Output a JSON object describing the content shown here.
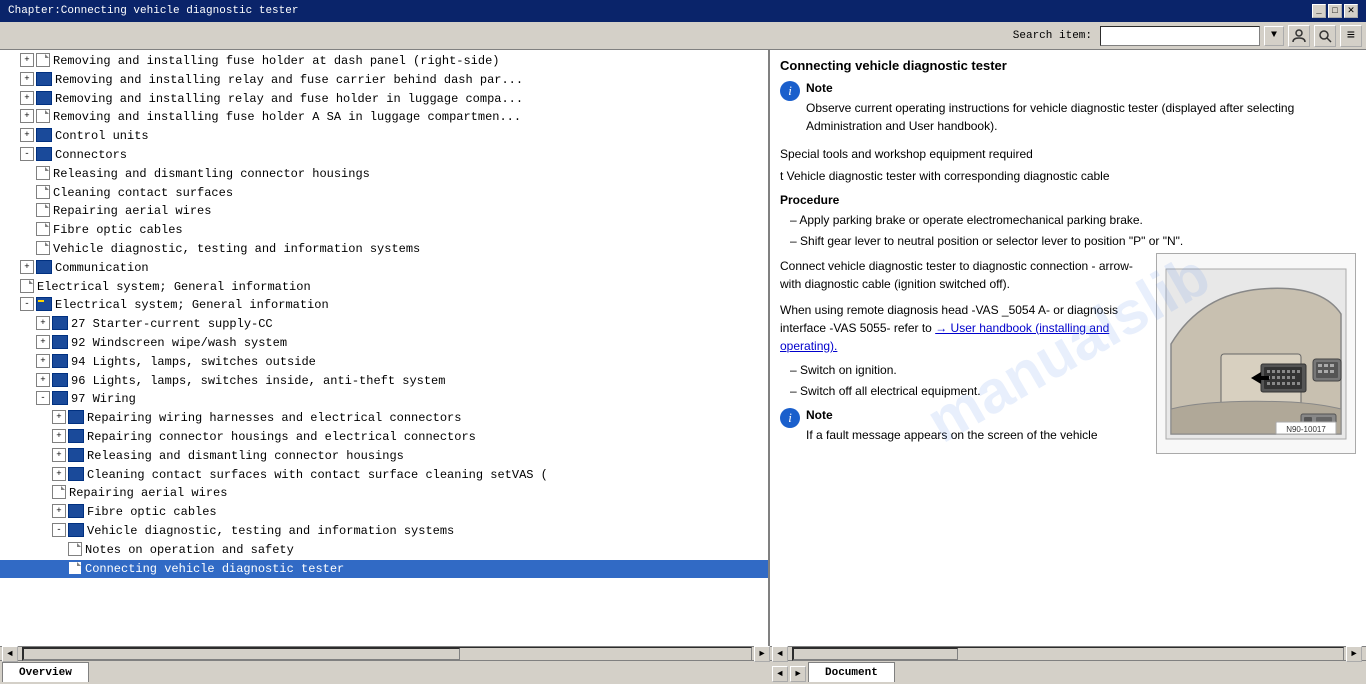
{
  "titlebar": {
    "title": "Chapter:Connecting vehicle diagnostic tester"
  },
  "toolbar": {
    "search_label": "Search item:",
    "search_placeholder": "",
    "btn_user": "👤",
    "btn_print": "🖨",
    "btn_menu": "☰"
  },
  "tree": {
    "items": [
      {
        "id": 1,
        "indent": "tree-indent-1",
        "type": "doc",
        "expand": "+",
        "label": "Removing and installing fuse holder at dash panel (right-side)"
      },
      {
        "id": 2,
        "indent": "tree-indent-1",
        "type": "doc",
        "expand": "+",
        "label": "Removing and installing relay and fuse carrier behind dash par..."
      },
      {
        "id": 3,
        "indent": "tree-indent-1",
        "type": "doc",
        "expand": "+",
        "label": "Removing and installing relay and fuse holder in luggage compa..."
      },
      {
        "id": 4,
        "indent": "tree-indent-1",
        "type": "doc",
        "expand": "+",
        "label": "Removing and installing fuse holder A SA in luggage compartmen..."
      },
      {
        "id": 5,
        "indent": "tree-indent-1",
        "type": "book",
        "expand": "+",
        "label": "Control units"
      },
      {
        "id": 6,
        "indent": "tree-indent-1",
        "type": "book",
        "expand": "-",
        "label": "Connectors"
      },
      {
        "id": 7,
        "indent": "tree-indent-2",
        "type": "doc",
        "label": "Releasing and dismantling connector housings"
      },
      {
        "id": 8,
        "indent": "tree-indent-2",
        "type": "doc",
        "label": "Cleaning contact surfaces"
      },
      {
        "id": 9,
        "indent": "tree-indent-2",
        "type": "doc",
        "label": "Repairing aerial wires"
      },
      {
        "id": 10,
        "indent": "tree-indent-2",
        "type": "doc",
        "label": "Fibre optic cables"
      },
      {
        "id": 11,
        "indent": "tree-indent-2",
        "type": "doc",
        "label": "Vehicle diagnostic, testing and information systems"
      },
      {
        "id": 12,
        "indent": "tree-indent-1",
        "type": "book",
        "expand": "+",
        "label": "Communication"
      },
      {
        "id": 13,
        "indent": "tree-indent-1",
        "type": "doc",
        "label": "Electrical system; General information"
      },
      {
        "id": 14,
        "indent": "tree-indent-1",
        "type": "book",
        "expand": "-",
        "label": "Electrical system; General information"
      },
      {
        "id": 15,
        "indent": "tree-indent-2",
        "type": "book",
        "expand": "+",
        "label": "27 Starter-current supply-CC"
      },
      {
        "id": 16,
        "indent": "tree-indent-2",
        "type": "book",
        "expand": "+",
        "label": "92 Windscreen wipe/wash system"
      },
      {
        "id": 17,
        "indent": "tree-indent-2",
        "type": "book",
        "expand": "+",
        "label": "94 Lights, lamps, switches outside"
      },
      {
        "id": 18,
        "indent": "tree-indent-2",
        "type": "book",
        "expand": "+",
        "label": "96 Lights, lamps, switches inside, anti-theft system"
      },
      {
        "id": 19,
        "indent": "tree-indent-2",
        "type": "book",
        "expand": "-",
        "label": "97 Wiring"
      },
      {
        "id": 20,
        "indent": "tree-indent-3",
        "type": "book",
        "expand": "+",
        "label": "Repairing wiring harnesses and electrical connectors"
      },
      {
        "id": 21,
        "indent": "tree-indent-3",
        "type": "book",
        "expand": "+",
        "label": "Repairing connector housings and electrical connectors"
      },
      {
        "id": 22,
        "indent": "tree-indent-3",
        "type": "book",
        "expand": "+",
        "label": "Releasing and dismantling connector housings"
      },
      {
        "id": 23,
        "indent": "tree-indent-3",
        "type": "book",
        "expand": "+",
        "label": "Cleaning contact surfaces with contact surface cleaning setVAS ("
      },
      {
        "id": 24,
        "indent": "tree-indent-3",
        "type": "doc",
        "label": "Repairing aerial wires"
      },
      {
        "id": 25,
        "indent": "tree-indent-3",
        "type": "book",
        "expand": "+",
        "label": "Fibre optic cables"
      },
      {
        "id": 26,
        "indent": "tree-indent-3",
        "type": "book",
        "expand": "-",
        "label": "Vehicle diagnostic, testing and information systems"
      },
      {
        "id": 27,
        "indent": "tree-indent-4",
        "type": "doc",
        "label": "Notes on operation and safety"
      },
      {
        "id": 28,
        "indent": "tree-indent-4",
        "type": "doc",
        "label": "Connecting vehicle diagnostic tester",
        "active": true
      }
    ]
  },
  "right": {
    "title": "Connecting vehicle diagnostic tester",
    "note_label": "Note",
    "note_text": "Observe current operating instructions for vehicle diagnostic tester (displayed after selecting Administration and User handbook).",
    "special_tools": "Special tools and workshop equipment required",
    "tool_item": "t  Vehicle diagnostic tester with corresponding diagnostic cable",
    "procedure_header": "Procedure",
    "steps": [
      "Apply parking brake or operate electromechanical parking brake.",
      "Shift gear lever to neutral position or selector lever to position \"P\" or \"N\"."
    ],
    "connect_text": "Connect vehicle diagnostic tester to diagnostic connection - arrow- with diagnostic cable (ignition switched off).",
    "remote_text": "When using remote diagnosis head -VAS _5054 A- or diagnosis interface -VAS 5055- refer to",
    "link_text": "→ User handbook (installing and operating).",
    "switch_on": "Switch on ignition.",
    "switch_off": "Switch off all electrical equipment.",
    "note2_label": "Note",
    "note2_text": "If a fault message appears on the screen of the vehicle",
    "diagram_label": "N90-10017",
    "watermark": "manualslib"
  },
  "tabs": {
    "left_tab": "Overview",
    "right_tab": "Document"
  }
}
